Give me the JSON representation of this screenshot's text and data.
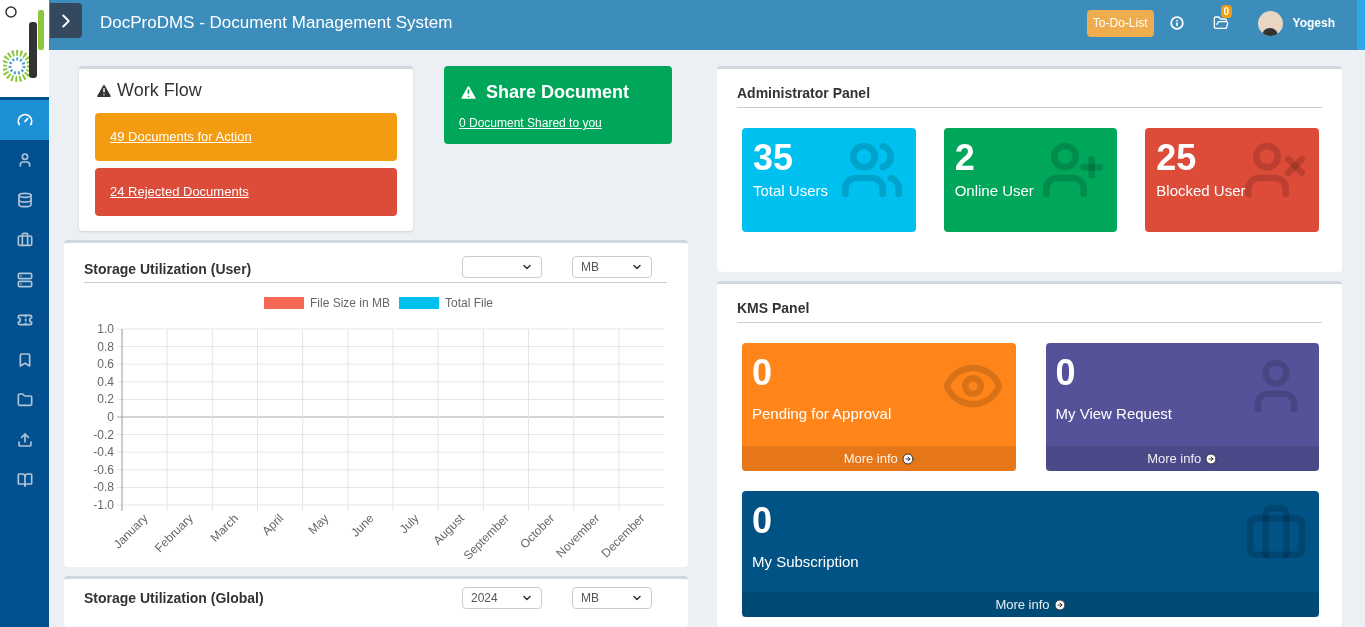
{
  "header": {
    "title": "DocProDMS - Document Management System",
    "todo_button": "To-Do-List",
    "notification_count": "0",
    "user_name": "Yogesh"
  },
  "sidebar": {
    "items": [
      {
        "kind": "dashboard",
        "selected": true
      },
      {
        "kind": "user",
        "selected": false
      },
      {
        "kind": "database",
        "selected": false
      },
      {
        "kind": "briefcase",
        "selected": false
      },
      {
        "kind": "server",
        "selected": false
      },
      {
        "kind": "ticket",
        "selected": false
      },
      {
        "kind": "bookmark",
        "selected": false
      },
      {
        "kind": "folder",
        "selected": false
      },
      {
        "kind": "upload",
        "selected": false
      },
      {
        "kind": "book",
        "selected": false
      }
    ]
  },
  "workflow": {
    "title": "Work Flow",
    "items": [
      {
        "label": "49 Documents for Action",
        "color": "#f39c12"
      },
      {
        "label": "24 Rejected Documents",
        "color": "#dd4b39"
      }
    ]
  },
  "share": {
    "title": "Share Document",
    "link": "0 Document Shared to you"
  },
  "storage_user": {
    "title": "Storage Utilization (User)",
    "unit_select": "MB",
    "chart_data": {
      "type": "bar",
      "categories": [
        "January",
        "February",
        "March",
        "April",
        "May",
        "June",
        "July",
        "August",
        "September",
        "October",
        "November",
        "December"
      ],
      "series": [
        {
          "name": "File Size in MB",
          "color": "#f56954",
          "values": [
            null,
            null,
            null,
            null,
            null,
            null,
            null,
            null,
            null,
            null,
            null,
            null
          ]
        },
        {
          "name": "Total File",
          "color": "#00c0ef",
          "values": [
            null,
            null,
            null,
            null,
            null,
            null,
            null,
            null,
            null,
            null,
            null,
            null
          ]
        }
      ],
      "grid": true,
      "ylim": [
        -1,
        1
      ],
      "yticks": [
        {
          "value": 1,
          "label": "1.0"
        },
        0.8,
        0.6,
        0.4,
        0.2,
        0,
        -0.2,
        -0.4,
        -0.6,
        -0.8,
        {
          "value": -1,
          "label": "-1.0"
        }
      ]
    }
  },
  "storage_global": {
    "title": "Storage Utilization (Global)",
    "year_select": "2024",
    "unit_select": "MB"
  },
  "admin_panel": {
    "title": "Administrator Panel",
    "cards": [
      {
        "value": "35",
        "label": "Total Users",
        "color": "#00c0ef",
        "kind": "users"
      },
      {
        "value": "2",
        "label": "Online User",
        "color": "#00a65a",
        "kind": "user_add"
      },
      {
        "value": "25",
        "label": "Blocked User",
        "color": "#dd4b39",
        "kind": "user_block"
      }
    ]
  },
  "kms_panel": {
    "title": "KMS Panel",
    "cards": [
      {
        "value": "0",
        "label": "Pending for Approval",
        "more": "More info",
        "color": "#ff851b",
        "kind": "eye"
      },
      {
        "value": "0",
        "label": "My View Request",
        "more": "More info",
        "color": "#555299",
        "kind": "user"
      },
      {
        "value": "0",
        "label": "My Subscription",
        "more": "More info",
        "color": "#005384",
        "kind": "briefcase"
      }
    ]
  }
}
